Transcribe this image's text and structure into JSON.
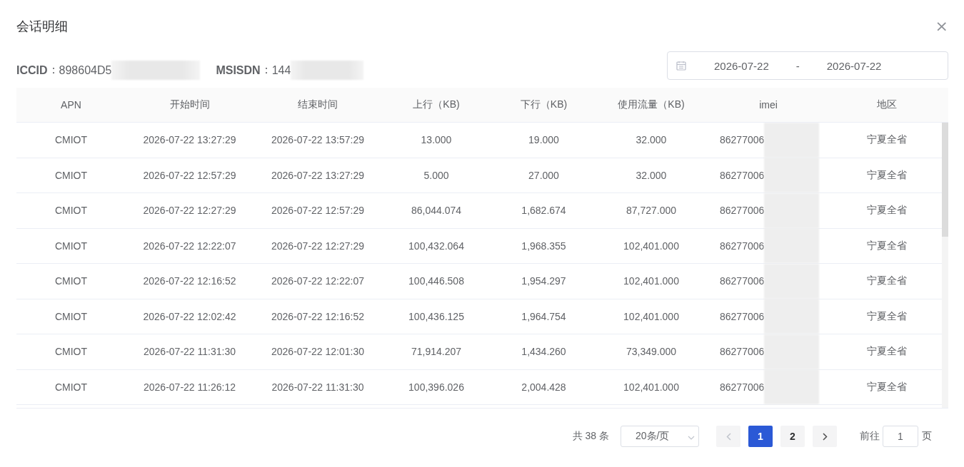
{
  "dialog": {
    "title": "会话明细",
    "close": "×"
  },
  "info": [
    {
      "label": "ICCID",
      "sep": "：",
      "value": "898604D5"
    },
    {
      "label": "MSISDN",
      "sep": "：",
      "value": "144"
    }
  ],
  "date_range": {
    "start": "2026-07-22",
    "separator": "-",
    "end": "2026-07-22"
  },
  "table": {
    "columns": [
      "APN",
      "开始时间",
      "结束时间",
      "上行（KB)",
      "下行（KB)",
      "使用流量（KB)",
      "imei",
      "地区"
    ],
    "rows": [
      [
        "CMIOT",
        "2026-07-22 13:27:29",
        "2026-07-22 13:57:29",
        "13.000",
        "19.000",
        "32.000",
        "86277006",
        "宁夏全省"
      ],
      [
        "CMIOT",
        "2026-07-22 12:57:29",
        "2026-07-22 13:27:29",
        "5.000",
        "27.000",
        "32.000",
        "86277006",
        "宁夏全省"
      ],
      [
        "CMIOT",
        "2026-07-22 12:27:29",
        "2026-07-22 12:57:29",
        "86,044.074",
        "1,682.674",
        "87,727.000",
        "86277006",
        "宁夏全省"
      ],
      [
        "CMIOT",
        "2026-07-22 12:22:07",
        "2026-07-22 12:27:29",
        "100,432.064",
        "1,968.355",
        "102,401.000",
        "86277006",
        "宁夏全省"
      ],
      [
        "CMIOT",
        "2026-07-22 12:16:52",
        "2026-07-22 12:22:07",
        "100,446.508",
        "1,954.297",
        "102,401.000",
        "86277006",
        "宁夏全省"
      ],
      [
        "CMIOT",
        "2026-07-22 12:02:42",
        "2026-07-22 12:16:52",
        "100,436.125",
        "1,964.754",
        "102,401.000",
        "86277006",
        "宁夏全省"
      ],
      [
        "CMIOT",
        "2026-07-22 11:31:30",
        "2026-07-22 12:01:30",
        "71,914.207",
        "1,434.260",
        "73,349.000",
        "86277006",
        "宁夏全省"
      ],
      [
        "CMIOT",
        "2026-07-22 11:26:12",
        "2026-07-22 11:31:30",
        "100,396.026",
        "2,004.428",
        "102,401.000",
        "86277006",
        "宁夏全省"
      ]
    ]
  },
  "pagination": {
    "total": "共 38 条",
    "page_size": "20条/页",
    "pages": [
      {
        "label": "1",
        "selected": true
      },
      {
        "label": "2",
        "selected": false
      }
    ],
    "goto_label": "前往",
    "goto_value": "1",
    "goto_suffix": "页"
  }
}
